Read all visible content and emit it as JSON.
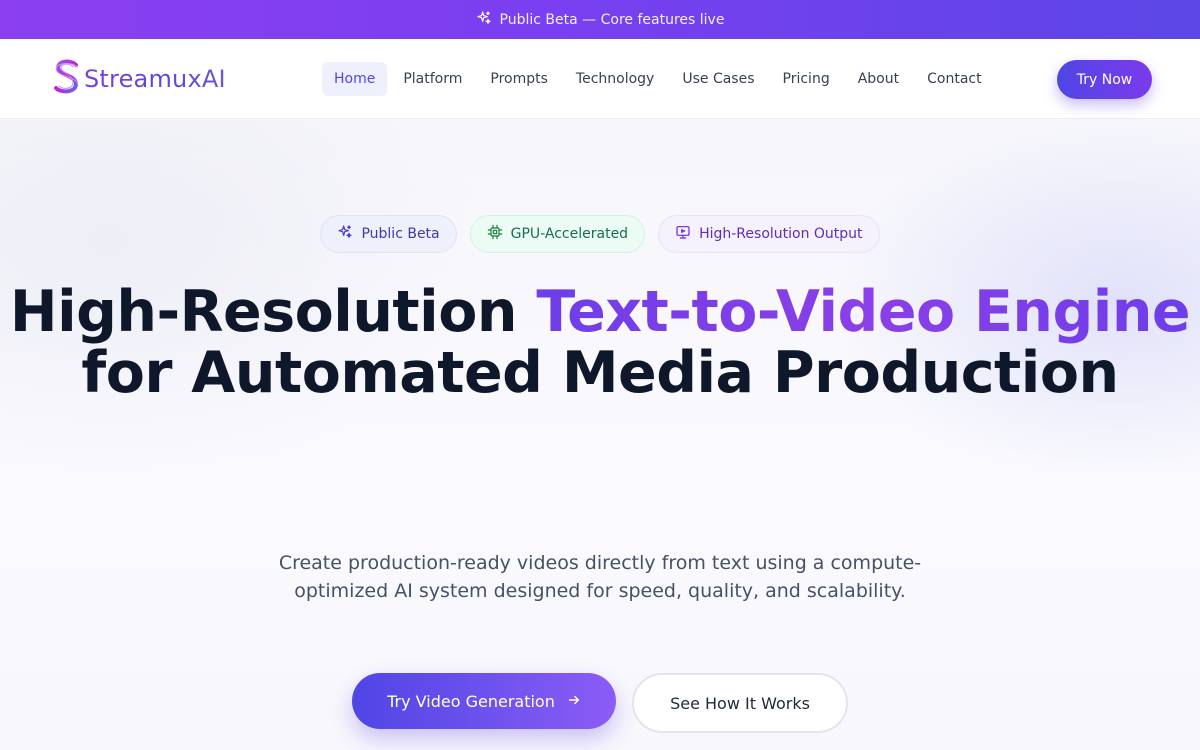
{
  "announcement": {
    "icon": "sparkles-icon",
    "text": "Public Beta — Core features live"
  },
  "navbar": {
    "brand": {
      "name": "StreamuxAI",
      "logo_icon": "stylized-s-logo-icon"
    },
    "links": [
      {
        "label": "Home",
        "active": true
      },
      {
        "label": "Platform",
        "active": false
      },
      {
        "label": "Prompts",
        "active": false
      },
      {
        "label": "Technology",
        "active": false
      },
      {
        "label": "Use Cases",
        "active": false
      },
      {
        "label": "Pricing",
        "active": false
      },
      {
        "label": "About",
        "active": false
      },
      {
        "label": "Contact",
        "active": false
      }
    ],
    "cta_label": "Try Now"
  },
  "hero": {
    "badges": [
      {
        "icon": "sparkles-icon",
        "label": "Public Beta"
      },
      {
        "icon": "cpu-chip-icon",
        "label": "GPU-Accelerated"
      },
      {
        "icon": "monitor-play-icon",
        "label": "High-Resolution Output"
      }
    ],
    "headline": {
      "part1": "High-Resolution",
      "accent": "Text-to-Video Engine",
      "part2": "for Automated Media Production"
    },
    "subtitle": "Create production-ready videos directly from text using a compute-optimized AI system designed for speed, quality, and scalability.",
    "primary_cta": {
      "label": "Try Video Generation",
      "icon": "arrow-right-icon"
    },
    "secondary_cta": {
      "label": "See How It Works"
    }
  },
  "colors": {
    "accent_indigo": "#4f46e5",
    "accent_violet": "#7c3aed",
    "banner_start": "#8b3ff0",
    "banner_end": "#5b46e6",
    "heading_text": "#0f172a",
    "body_text": "#475166"
  }
}
